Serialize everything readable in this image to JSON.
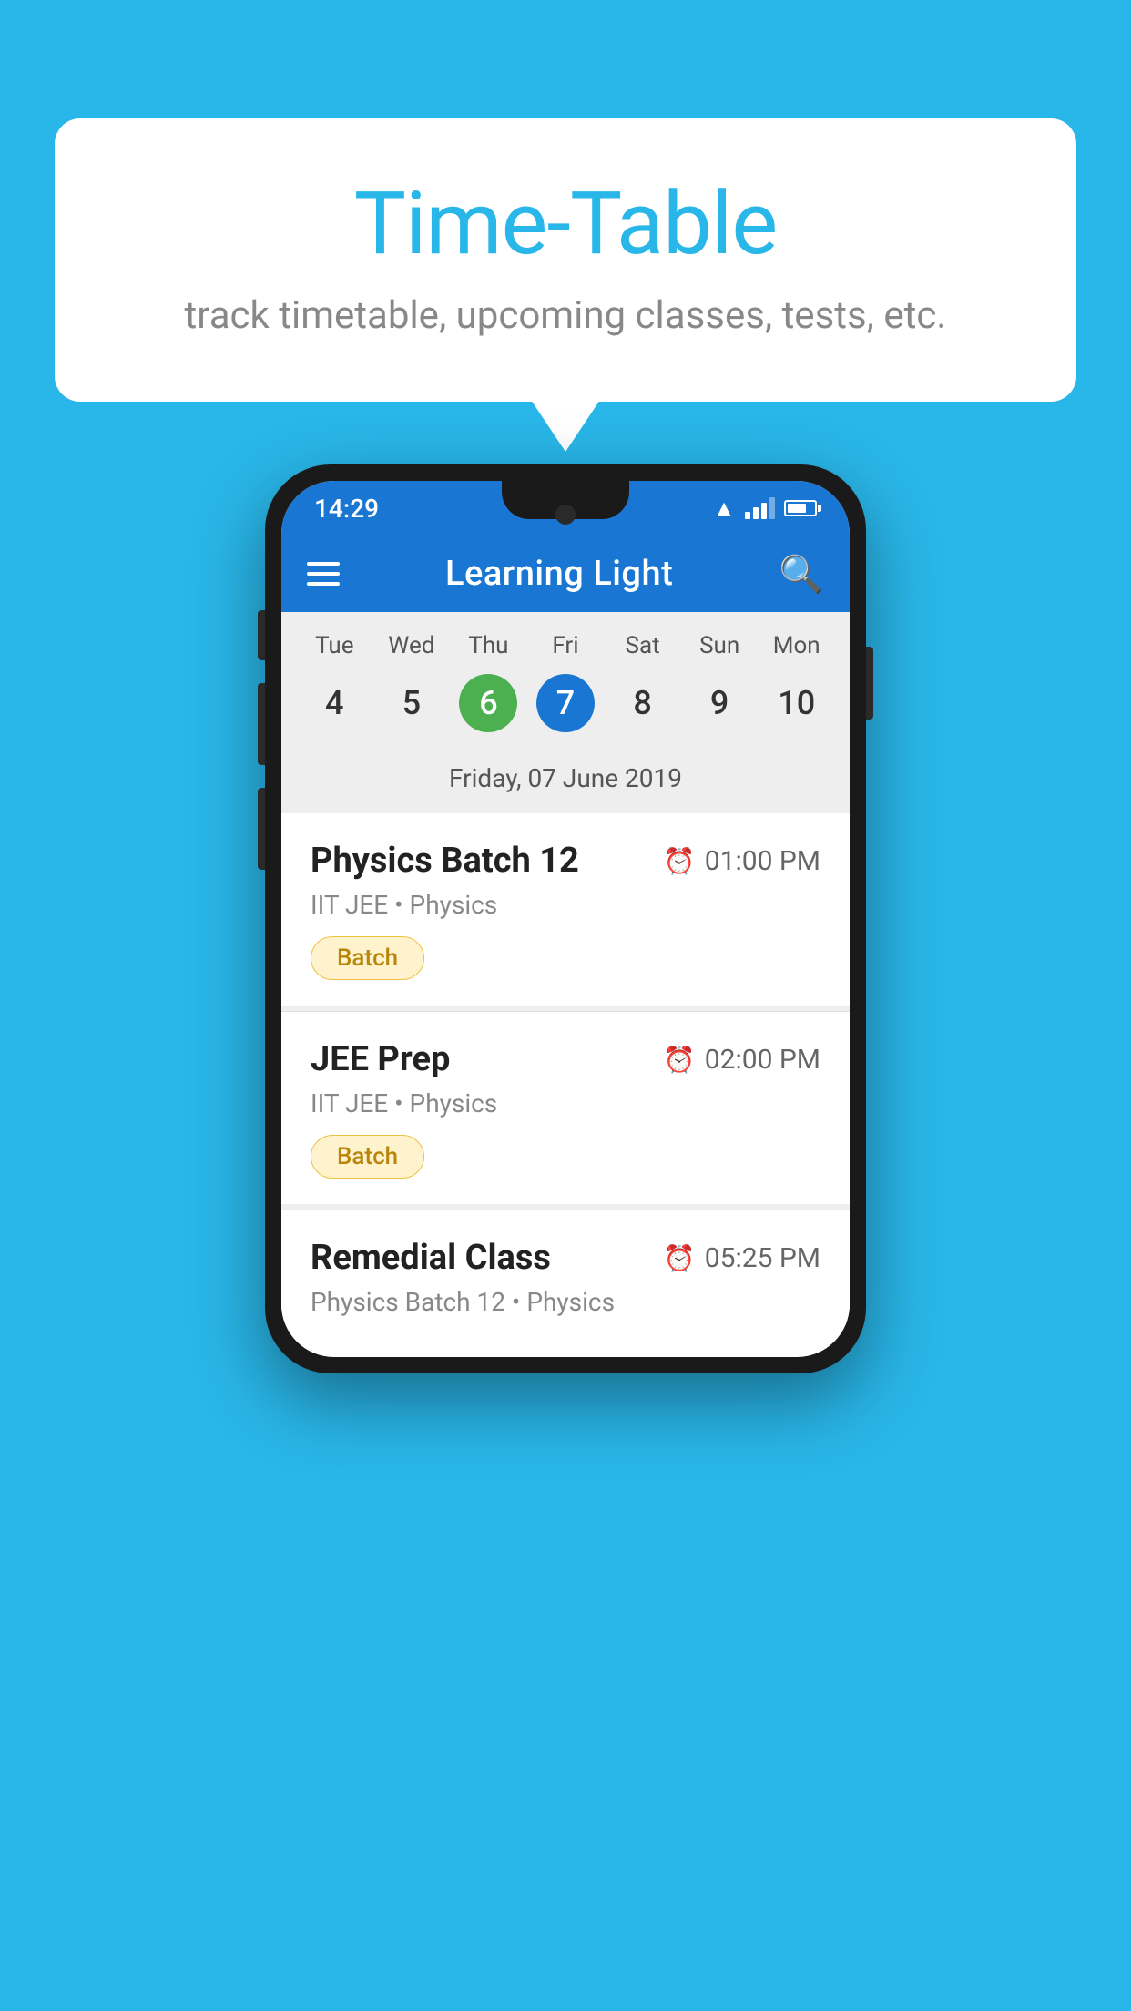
{
  "page": {
    "background_color": "#29b6e8"
  },
  "speech_bubble": {
    "title": "Time-Table",
    "subtitle": "track timetable, upcoming classes, tests, etc."
  },
  "phone": {
    "status_bar": {
      "time": "14:29"
    },
    "toolbar": {
      "title": "Learning Light",
      "hamburger_label": "menu",
      "search_label": "search"
    },
    "calendar": {
      "days": [
        "Tue",
        "Wed",
        "Thu",
        "Fri",
        "Sat",
        "Sun",
        "Mon"
      ],
      "dates": [
        "4",
        "5",
        "6",
        "7",
        "8",
        "9",
        "10"
      ],
      "today_index": 2,
      "selected_index": 3,
      "selected_date_label": "Friday, 07 June 2019"
    },
    "schedule": [
      {
        "title": "Physics Batch 12",
        "time": "01:00 PM",
        "subtitle": "IIT JEE • Physics",
        "badge": "Batch"
      },
      {
        "title": "JEE Prep",
        "time": "02:00 PM",
        "subtitle": "IIT JEE • Physics",
        "badge": "Batch"
      },
      {
        "title": "Remedial Class",
        "time": "05:25 PM",
        "subtitle": "Physics Batch 12 • Physics",
        "badge": null
      }
    ]
  }
}
